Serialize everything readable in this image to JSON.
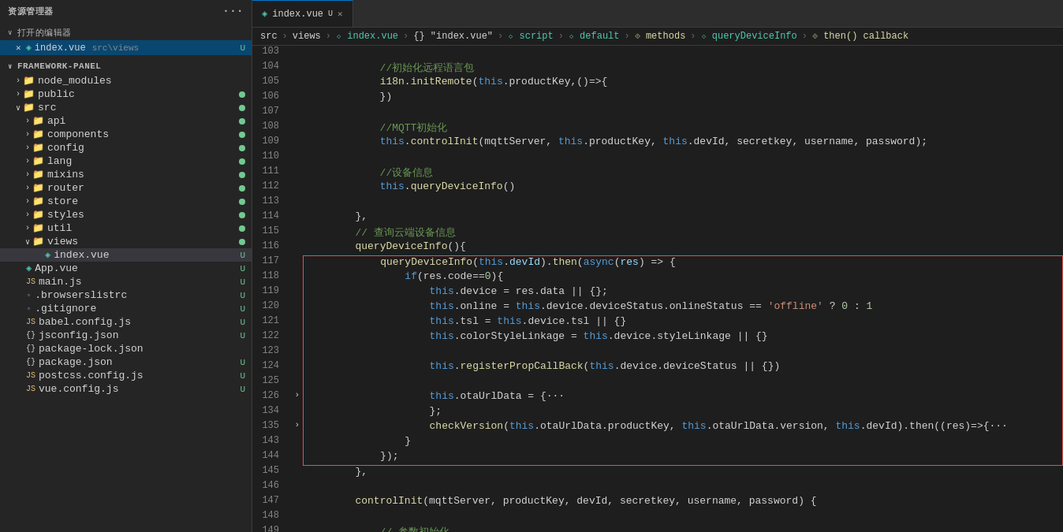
{
  "sidebar": {
    "title": "资源管理器",
    "more_icon": "···",
    "open_editors_label": "打开的编辑器",
    "open_editors_arrow": "∨",
    "open_file": {
      "close": "×",
      "icon": "◈",
      "name": "index.vue",
      "path": "src\\views",
      "badge": "U"
    },
    "framework_label": "FRAMEWORK-PANEL",
    "framework_arrow": "∨",
    "tree": [
      {
        "level": 1,
        "arrow": "›",
        "icon": "folder",
        "name": "node_modules",
        "badge": ""
      },
      {
        "level": 1,
        "arrow": "›",
        "icon": "folder",
        "name": "public",
        "badge": "dot"
      },
      {
        "level": 1,
        "arrow": "∨",
        "icon": "folder",
        "name": "src",
        "badge": "dot"
      },
      {
        "level": 2,
        "arrow": "›",
        "icon": "folder",
        "name": "api",
        "badge": "dot"
      },
      {
        "level": 2,
        "arrow": "›",
        "icon": "folder",
        "name": "components",
        "badge": "dot"
      },
      {
        "level": 2,
        "arrow": "›",
        "icon": "folder",
        "name": "config",
        "badge": "dot"
      },
      {
        "level": 2,
        "arrow": "›",
        "icon": "folder",
        "name": "lang",
        "badge": "dot"
      },
      {
        "level": 2,
        "arrow": "›",
        "icon": "folder",
        "name": "mixins",
        "badge": "dot"
      },
      {
        "level": 2,
        "arrow": "›",
        "icon": "folder",
        "name": "router",
        "badge": "dot"
      },
      {
        "level": 2,
        "arrow": "›",
        "icon": "folder",
        "name": "store",
        "badge": "dot"
      },
      {
        "level": 2,
        "arrow": "›",
        "icon": "folder",
        "name": "styles",
        "badge": "dot"
      },
      {
        "level": 2,
        "arrow": "›",
        "icon": "folder",
        "name": "util",
        "badge": "dot"
      },
      {
        "level": 2,
        "arrow": "∨",
        "icon": "folder",
        "name": "views",
        "badge": "dot"
      },
      {
        "level": 3,
        "arrow": "",
        "icon": "vue",
        "name": "index.vue",
        "badge": "U",
        "active": true
      },
      {
        "level": 1,
        "arrow": "",
        "icon": "vue",
        "name": "App.vue",
        "badge": "U"
      },
      {
        "level": 1,
        "arrow": "",
        "icon": "js",
        "name": "main.js",
        "badge": "U"
      },
      {
        "level": 1,
        "arrow": "",
        "icon": "other",
        "name": ".browserslistrc",
        "badge": "U"
      },
      {
        "level": 1,
        "arrow": "",
        "icon": "other",
        "name": ".gitignore",
        "badge": "U"
      },
      {
        "level": 1,
        "arrow": "",
        "icon": "js",
        "name": "babel.config.js",
        "badge": "U"
      },
      {
        "level": 1,
        "arrow": "",
        "icon": "json",
        "name": "jsconfig.json",
        "badge": "U"
      },
      {
        "level": 1,
        "arrow": "",
        "icon": "json",
        "name": "package-lock.json",
        "badge": ""
      },
      {
        "level": 1,
        "arrow": "",
        "icon": "json",
        "name": "package.json",
        "badge": "U"
      },
      {
        "level": 1,
        "arrow": "",
        "icon": "js",
        "name": "postcss.config.js",
        "badge": "U"
      },
      {
        "level": 1,
        "arrow": "",
        "icon": "js",
        "name": "vue.config.js",
        "badge": "U"
      }
    ]
  },
  "editor": {
    "tab_name": "index.vue",
    "tab_modified": "U",
    "breadcrumb": [
      "src",
      ">",
      "views",
      ">",
      "⬦ index.vue",
      ">",
      "{} \"index.vue\"",
      ">",
      "⬦ script",
      ">",
      "⬦ default",
      ">",
      "⟐ methods",
      ">",
      "⬦ queryDeviceInfo",
      ">",
      "⟐ then() callback"
    ]
  },
  "code_lines": [
    {
      "num": 103,
      "content": ""
    },
    {
      "num": 104,
      "content": "            //初始化远程语言包",
      "type": "comment"
    },
    {
      "num": 105,
      "content": "            i18n.initRemote(this.productKey,()=>{",
      "type": "code"
    },
    {
      "num": 106,
      "content": "            })",
      "type": "code"
    },
    {
      "num": 107,
      "content": ""
    },
    {
      "num": 108,
      "content": "            //MQTT初始化",
      "type": "comment"
    },
    {
      "num": 109,
      "content": "            this.controlInit(mqttServer, this.productKey, this.devId, secretkey, username, password);",
      "type": "code"
    },
    {
      "num": 110,
      "content": ""
    },
    {
      "num": 111,
      "content": "            //设备信息",
      "type": "comment"
    },
    {
      "num": 112,
      "content": "            this.queryDeviceInfo()",
      "type": "code"
    },
    {
      "num": 113,
      "content": ""
    },
    {
      "num": 114,
      "content": "        },",
      "type": "code"
    },
    {
      "num": 115,
      "content": "        // 查询云端设备信息",
      "type": "comment"
    },
    {
      "num": 116,
      "content": "        queryDeviceInfo(){",
      "type": "code"
    },
    {
      "num": 117,
      "content": "            queryDeviceInfo(this.devId).then(async(res) => {",
      "type": "code",
      "highlight": "red-start"
    },
    {
      "num": 118,
      "content": "                if(res.code==0){",
      "type": "code",
      "in_block": true
    },
    {
      "num": 119,
      "content": "                    this.device = res.data || {};",
      "type": "code",
      "in_block": true
    },
    {
      "num": 120,
      "content": "                    this.online = this.device.deviceStatus.onlineStatus == 'offline' ? 0 : 1",
      "type": "code",
      "in_block": true
    },
    {
      "num": 121,
      "content": "                    this.tsl = this.device.tsl || {}",
      "type": "code",
      "in_block": true
    },
    {
      "num": 122,
      "content": "                    this.colorStyleLinkage = this.device.styleLinkage || {}",
      "type": "code",
      "in_block": true
    },
    {
      "num": 123,
      "content": ""
    },
    {
      "num": 124,
      "content": "                    this.registerPropCallBack(this.device.deviceStatus || {})",
      "type": "code",
      "in_block": true
    },
    {
      "num": 125,
      "content": ""
    },
    {
      "num": 126,
      "content": "                    this.otaUrlData = {···",
      "type": "code",
      "in_block": true,
      "has_arrow": true
    },
    {
      "num": 134,
      "content": "                    };",
      "type": "code",
      "in_block": true
    },
    {
      "num": 135,
      "content": "                    checkVersion(this.otaUrlData.productKey, this.otaUrlData.version, this.devId).then((res)=>{···",
      "type": "code",
      "in_block": true,
      "has_arrow": true
    },
    {
      "num": 143,
      "content": "                }",
      "type": "code",
      "in_block": true
    },
    {
      "num": 144,
      "content": "            });",
      "type": "code",
      "in_block": true,
      "block_end": true
    },
    {
      "num": 145,
      "content": "        },"
    },
    {
      "num": 146,
      "content": ""
    },
    {
      "num": 147,
      "content": "        controlInit(mqttServer, productKey, devId, secretkey, username, password) {",
      "type": "code"
    },
    {
      "num": 148,
      "content": ""
    },
    {
      "num": 149,
      "content": "            // 参数初始化",
      "type": "comment"
    }
  ]
}
